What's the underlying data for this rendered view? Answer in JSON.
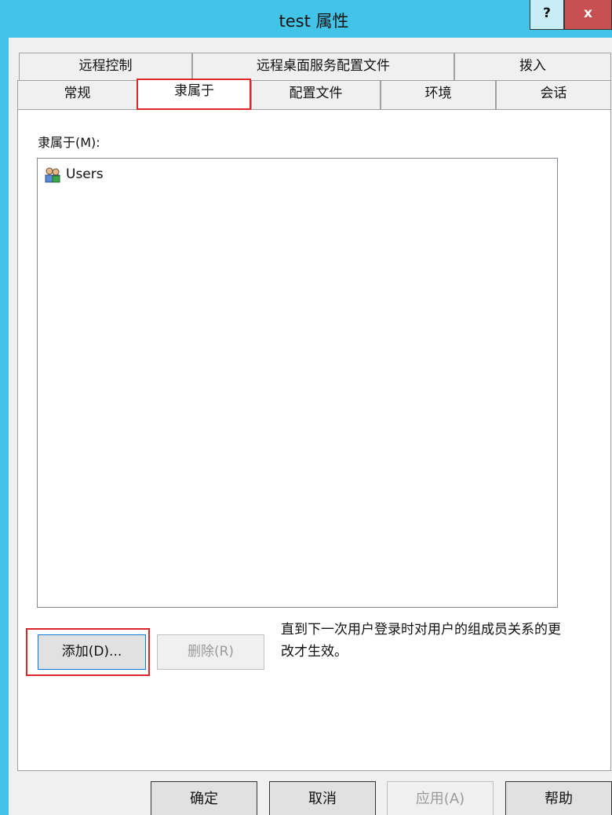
{
  "window": {
    "title": "test 属性",
    "help_label": "?",
    "close_label": "x"
  },
  "tabs": {
    "row1": [
      {
        "label": "远程控制"
      },
      {
        "label": "远程桌面服务配置文件"
      },
      {
        "label": "拨入"
      }
    ],
    "row2": [
      {
        "label": "常规"
      },
      {
        "label": "隶属于",
        "active": true
      },
      {
        "label": "配置文件"
      },
      {
        "label": "环境"
      },
      {
        "label": "会话"
      }
    ]
  },
  "member_of": {
    "label": "隶属于(M):",
    "items": [
      {
        "name": "Users",
        "icon": "group-icon"
      }
    ]
  },
  "actions": {
    "add_label": "添加(D)...",
    "remove_label": "删除(R)",
    "note": "直到下一次用户登录时对用户的组成员关系的更改才生效。"
  },
  "footer": {
    "ok_label": "确定",
    "cancel_label": "取消",
    "apply_label": "应用(A)",
    "help_label": "帮助"
  },
  "colors": {
    "title_bar": "#41c4e8",
    "close_button": "#c75050",
    "highlight": "#e0262c"
  }
}
